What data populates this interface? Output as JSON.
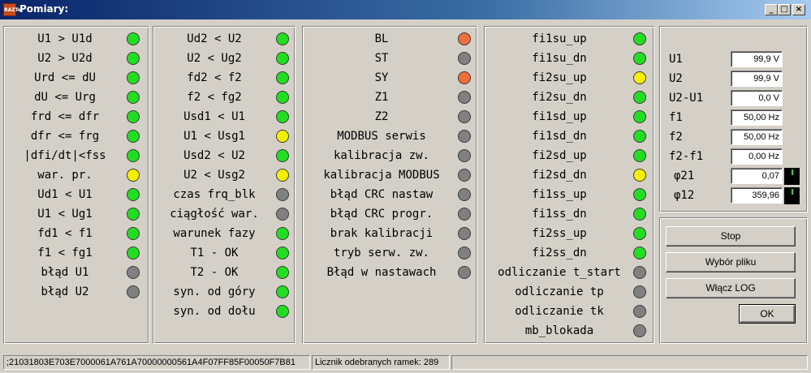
{
  "window": {
    "title": "Pomiary:",
    "app_icon_text": "RAZTel",
    "minimize": "_",
    "maximize": "□",
    "close": "×"
  },
  "panels": [
    {
      "items": [
        {
          "label": "U1 > U1d",
          "led": "green"
        },
        {
          "label": "U2 > U2d",
          "led": "green"
        },
        {
          "label": "Urd <= dU",
          "led": "green"
        },
        {
          "label": "dU <= Urg",
          "led": "green"
        },
        {
          "label": "frd <= dfr",
          "led": "green"
        },
        {
          "label": "dfr <= frg",
          "led": "green"
        },
        {
          "label": "|dfi/dt|<fss",
          "led": "green"
        },
        {
          "label": "war. pr.",
          "led": "yellow"
        },
        {
          "label": "Ud1 < U1",
          "led": "green"
        },
        {
          "label": "U1 < Ug1",
          "led": "green"
        },
        {
          "label": "fd1 < f1",
          "led": "green"
        },
        {
          "label": "f1 < fg1",
          "led": "green"
        },
        {
          "label": "błąd U1",
          "led": "grey"
        },
        {
          "label": "błąd U2",
          "led": "grey"
        }
      ]
    },
    {
      "items": [
        {
          "label": "Ud2 < U2",
          "led": "green"
        },
        {
          "label": "U2 < Ug2",
          "led": "green"
        },
        {
          "label": "fd2 < f2",
          "led": "green"
        },
        {
          "label": "f2 < fg2",
          "led": "green"
        },
        {
          "label": "Usd1 < U1",
          "led": "green"
        },
        {
          "label": "U1 < Usg1",
          "led": "yellow"
        },
        {
          "label": "Usd2 < U2",
          "led": "green"
        },
        {
          "label": "U2 < Usg2",
          "led": "yellow"
        },
        {
          "label": "czas frq_blk",
          "led": "grey"
        },
        {
          "label": "ciągłość war.",
          "led": "grey"
        },
        {
          "label": "warunek fazy",
          "led": "green"
        },
        {
          "label": "T1 - OK",
          "led": "green"
        },
        {
          "label": "T2 - OK",
          "led": "green"
        },
        {
          "label": "syn. od góry",
          "led": "green"
        },
        {
          "label": "syn. od dołu",
          "led": "green"
        }
      ]
    },
    {
      "items": [
        {
          "label": "BL",
          "led": "orange"
        },
        {
          "label": "ST",
          "led": "grey"
        },
        {
          "label": "SY",
          "led": "orange"
        },
        {
          "label": "Z1",
          "led": "grey"
        },
        {
          "label": "Z2",
          "led": "grey"
        },
        {
          "label": "MODBUS serwis",
          "led": "grey"
        },
        {
          "label": "kalibracja zw.",
          "led": "grey"
        },
        {
          "label": "kalibracja MODBUS",
          "led": "grey"
        },
        {
          "label": "błąd CRC nastaw",
          "led": "grey"
        },
        {
          "label": "błąd CRC progr.",
          "led": "grey"
        },
        {
          "label": "brak kalibracji",
          "led": "grey"
        },
        {
          "label": "tryb serw. zw.",
          "led": "grey"
        },
        {
          "label": "Błąd w nastawach",
          "led": "grey"
        }
      ]
    },
    {
      "items": [
        {
          "label": "fi1su_up",
          "led": "green"
        },
        {
          "label": "fi1su_dn",
          "led": "green"
        },
        {
          "label": "fi2su_up",
          "led": "yellow"
        },
        {
          "label": "fi2su_dn",
          "led": "green"
        },
        {
          "label": "fi1sd_up",
          "led": "green"
        },
        {
          "label": "fi1sd_dn",
          "led": "green"
        },
        {
          "label": "fi2sd_up",
          "led": "green"
        },
        {
          "label": "fi2sd_dn",
          "led": "yellow"
        },
        {
          "label": "fi1ss_up",
          "led": "green"
        },
        {
          "label": "fi1ss_dn",
          "led": "green"
        },
        {
          "label": "fi2ss_up",
          "led": "green"
        },
        {
          "label": "fi2ss_dn",
          "led": "green"
        },
        {
          "label": "odliczanie t_start",
          "led": "grey"
        },
        {
          "label": "odliczanie tp",
          "led": "grey"
        },
        {
          "label": "odliczanie tk",
          "led": "grey"
        },
        {
          "label": "mb_blokada",
          "led": "grey"
        }
      ]
    }
  ],
  "measurements": [
    {
      "label": "U1",
      "value": "99,9 V"
    },
    {
      "label": "U2",
      "value": "99,9 V"
    },
    {
      "label": "U2-U1",
      "value": "0,0 V"
    },
    {
      "label": "f1",
      "value": "50,00 Hz"
    },
    {
      "label": "f2",
      "value": "50,00 Hz"
    },
    {
      "label": "f2-f1",
      "value": "0,00 Hz"
    },
    {
      "label": "φ21",
      "value": "0,07"
    },
    {
      "label": "φ12",
      "value": "359,96"
    }
  ],
  "buttons": {
    "stop": "Stop",
    "file": "Wybór pliku",
    "log": "Włącz LOG",
    "ok": "OK"
  },
  "status": {
    "frame": ";21031803E703E7000061A761A70000000561A4F07FF85F00050F7B81",
    "counter": "Licznik odebranych ramek: 289",
    "extra": ""
  },
  "colors": {
    "green": "#22dd22",
    "grey": "#808080",
    "yellow": "#f5f000",
    "orange": "#ee6e3e",
    "title_bar": "#0a246a"
  }
}
